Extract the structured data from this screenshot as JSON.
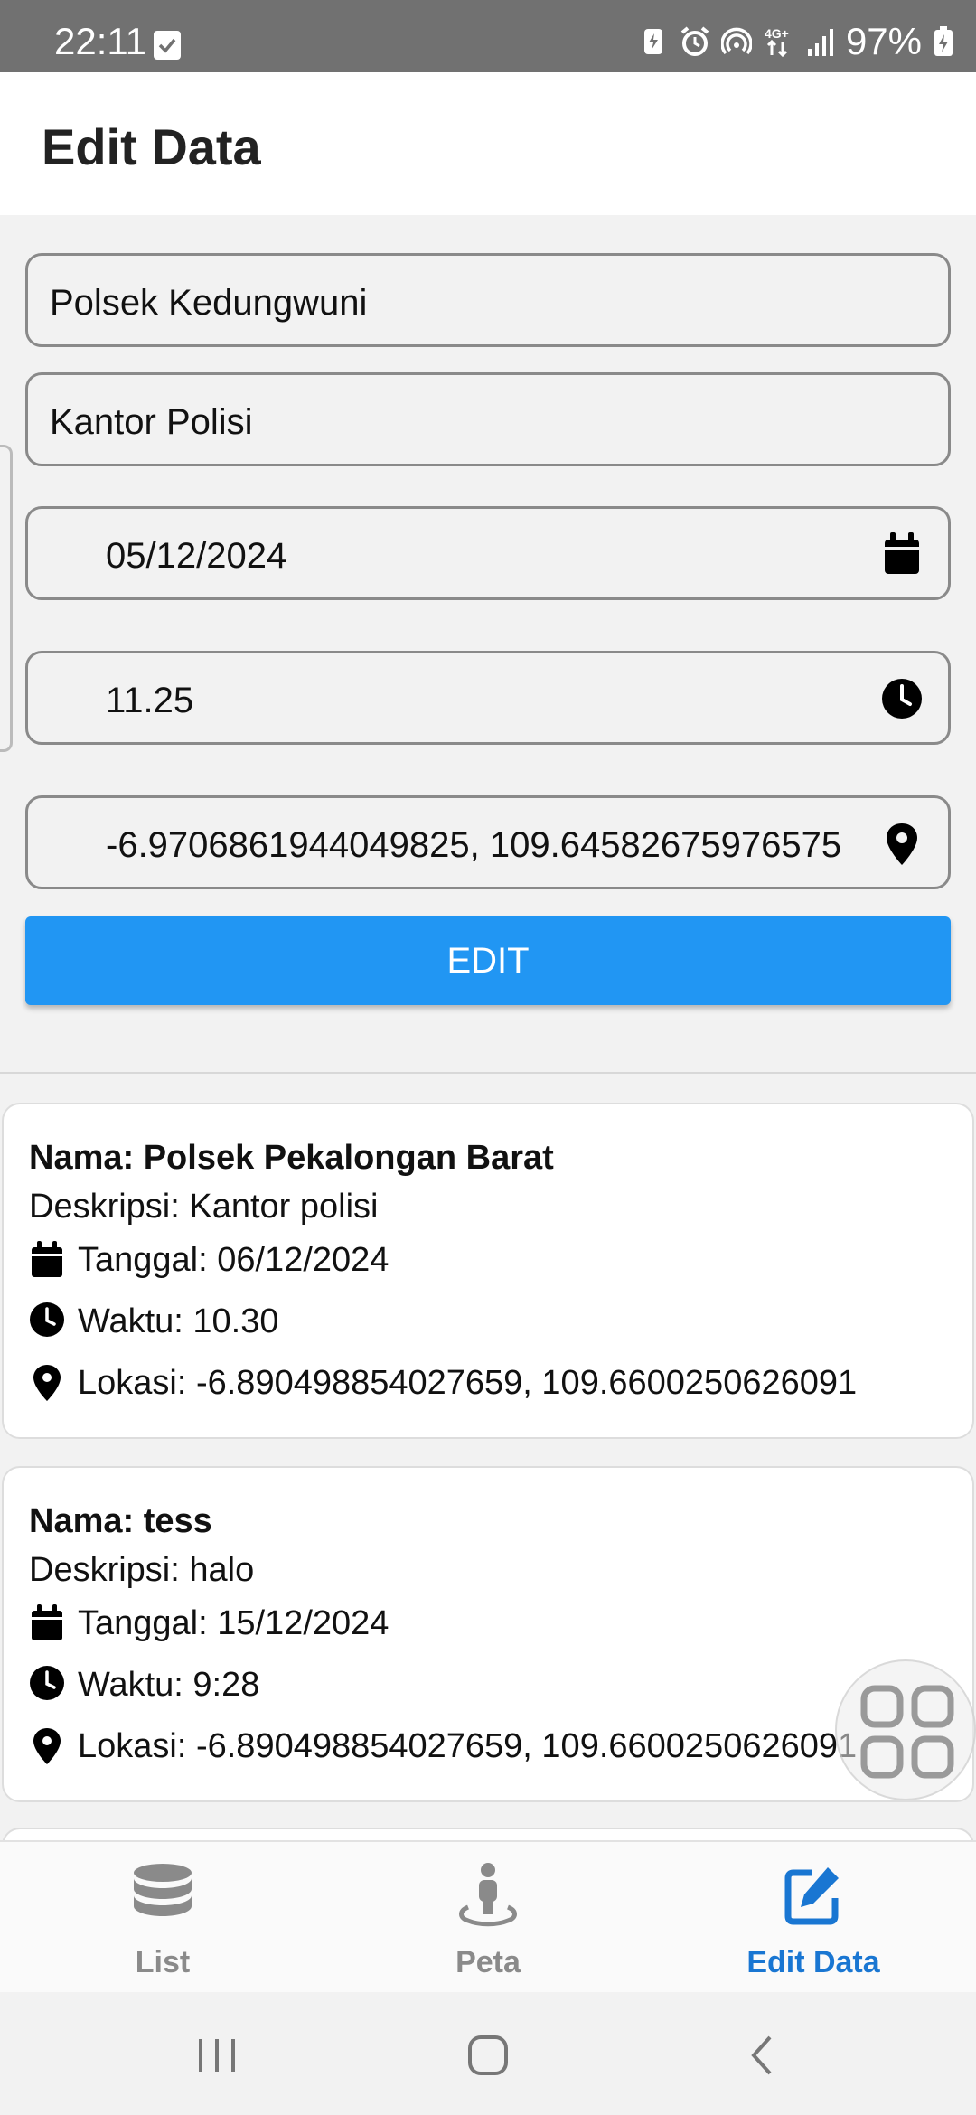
{
  "status_bar": {
    "time": "22:11",
    "battery": "97%",
    "icons": [
      "check-notification-icon",
      "battery-saver-icon",
      "alarm-icon",
      "hotspot-icon",
      "data-4g-icon",
      "signal-icon",
      "battery-charging-icon"
    ]
  },
  "appbar": {
    "title": "Edit Data"
  },
  "form": {
    "name": "Polsek Kedungwuni",
    "description": "Kantor Polisi",
    "date": "05/12/2024",
    "time": "11.25",
    "location": "-6.9706861944049825, 109.64582675976575",
    "submit_label": "EDIT"
  },
  "records": [
    {
      "name": "Nama: Polsek Pekalongan Barat",
      "description": "Deskripsi: Kantor polisi",
      "date": "Tanggal: 06/12/2024",
      "time": "Waktu: 10.30",
      "location": "Lokasi: -6.890498854027659, 109.6600250626091"
    },
    {
      "name": "Nama: tess",
      "description": "Deskripsi: halo",
      "date": "Tanggal: 15/12/2024",
      "time": "Waktu: 9:28",
      "location": "Lokasi: -6.890498854027659, 109.6600250626091"
    }
  ],
  "bottom_nav": {
    "items": [
      {
        "label": "List",
        "icon": "database-icon"
      },
      {
        "label": "Peta",
        "icon": "person-location-icon"
      },
      {
        "label": "Edit Data",
        "icon": "edit-square-icon"
      }
    ],
    "active": "Edit Data"
  },
  "colors": {
    "accent": "#2196f3",
    "active_nav": "#1976d2",
    "status_bar": "#717171"
  }
}
